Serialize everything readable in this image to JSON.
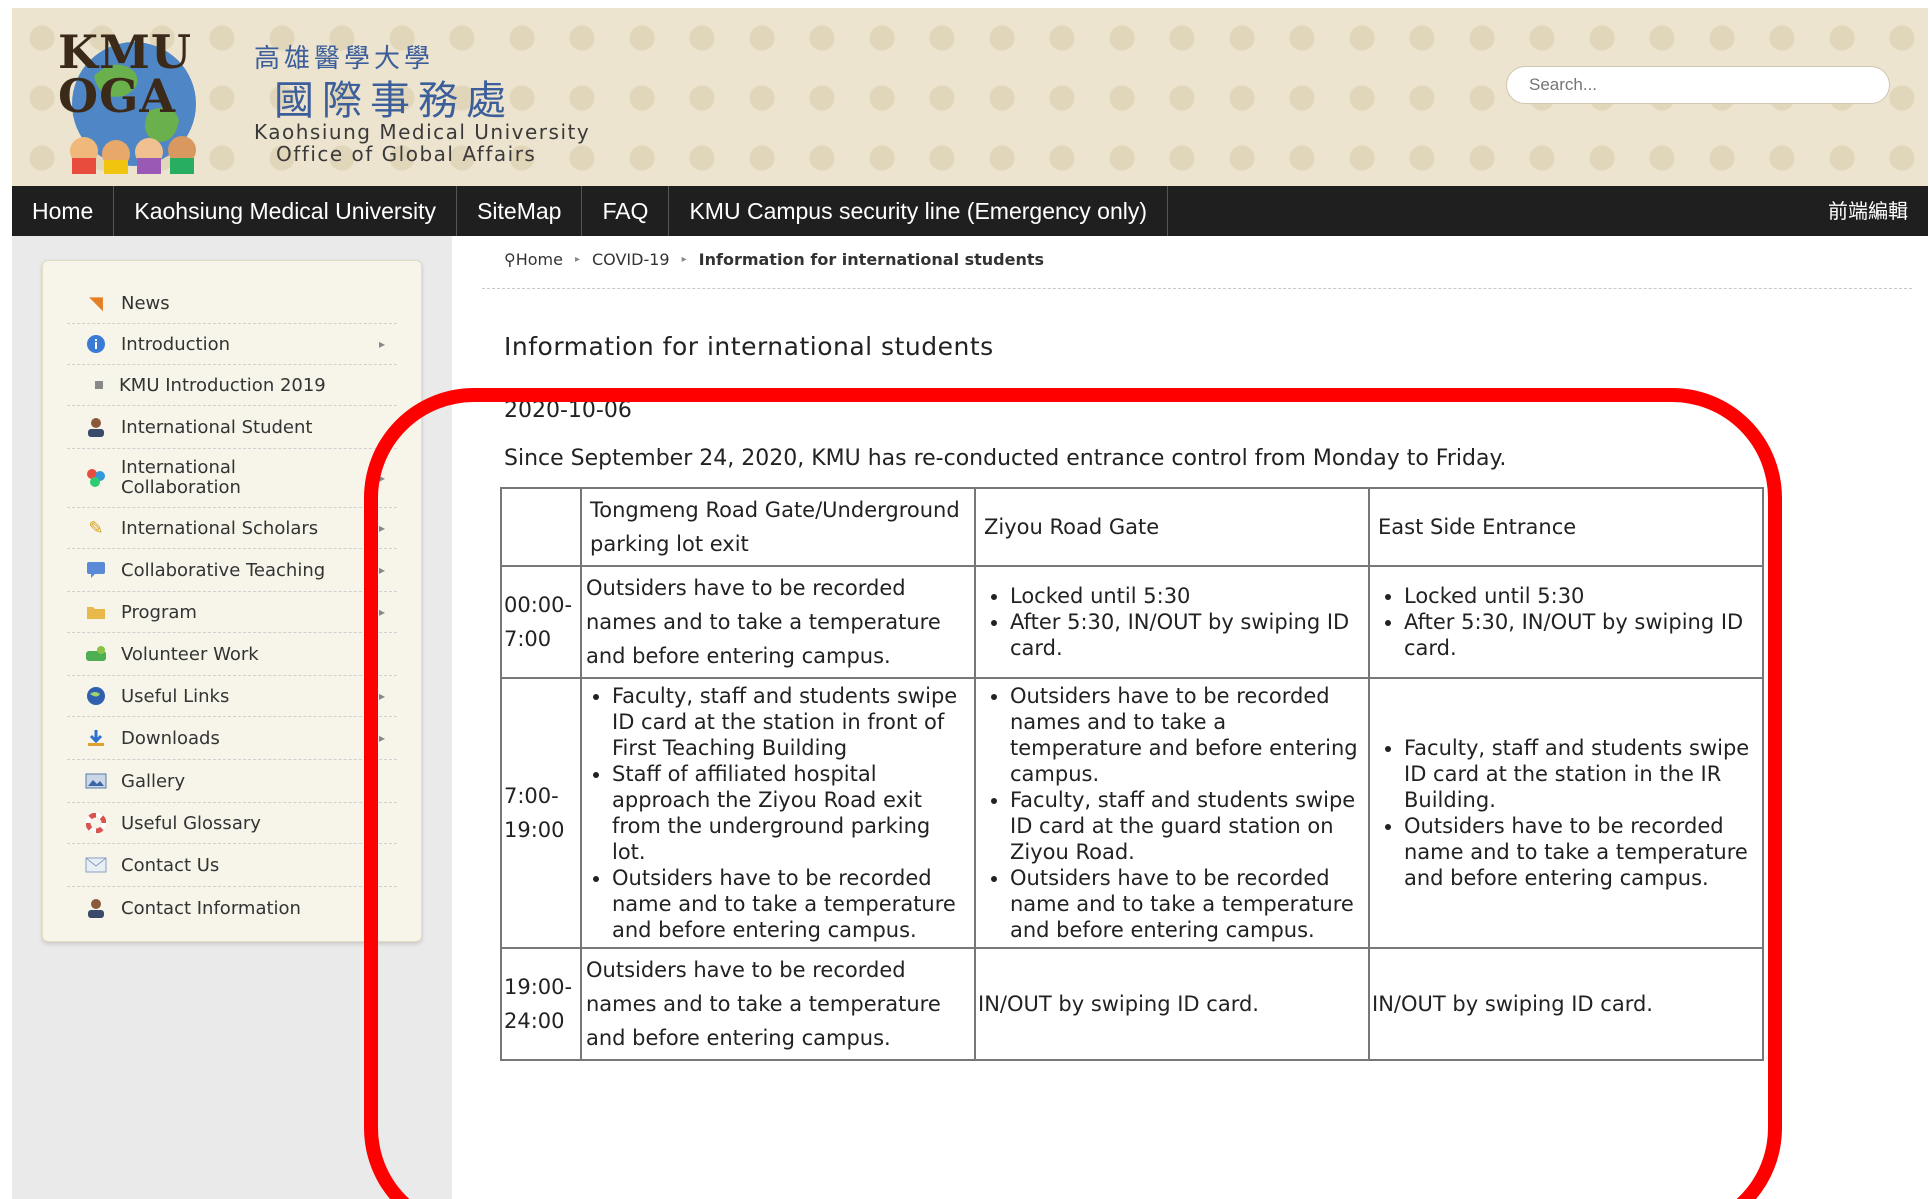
{
  "header": {
    "logo_text_1": "KMU",
    "logo_text_2": "OGA",
    "cn_university": "高雄醫學大學",
    "cn_office": "國際事務處",
    "en_university": "Kaohsiung Medical University",
    "en_office": "Office of Global Affairs",
    "search_placeholder": "Search..."
  },
  "nav": {
    "items": [
      "Home",
      "Kaohsiung Medical University",
      "SiteMap",
      "FAQ",
      "KMU Campus security line (Emergency only)"
    ],
    "right_label": "前端編輯"
  },
  "sidebar": {
    "items": [
      {
        "label": "News"
      },
      {
        "label": "Introduction"
      },
      {
        "label": "KMU Introduction 2019"
      },
      {
        "label": "International Student"
      },
      {
        "label": "International Collaboration"
      },
      {
        "label": "International Scholars"
      },
      {
        "label": "Collaborative Teaching"
      },
      {
        "label": "Program"
      },
      {
        "label": "Volunteer Work"
      },
      {
        "label": "Useful Links"
      },
      {
        "label": "Downloads"
      },
      {
        "label": "Gallery"
      },
      {
        "label": "Useful Glossary"
      },
      {
        "label": "Contact Us"
      },
      {
        "label": "Contact Information"
      }
    ]
  },
  "breadcrumb": {
    "home": "Home",
    "section": "COVID-19",
    "current": "Information for international students"
  },
  "article": {
    "title": "Information for international students",
    "date": "2020-10-06",
    "intro": "Since September 24, 2020, KMU has re-conducted entrance control from Monday to Friday."
  },
  "table": {
    "headers": [
      "",
      "Tongmeng Road Gate/Underground parking lot exit",
      "Ziyou Road Gate",
      "East Side Entrance"
    ],
    "rows": [
      {
        "time": "00:00-7:00",
        "tongmeng": "Outsiders have to be recorded names and to take a temperature and before entering campus.",
        "ziyou": [
          "Locked until 5:30",
          "After 5:30, IN/OUT by swiping ID card."
        ],
        "east": [
          "Locked until 5:30",
          "After 5:30, IN/OUT by swiping ID card."
        ]
      },
      {
        "time": "7:00-19:00",
        "tongmeng": [
          "Faculty, staff and students swipe ID card at the station in front of First Teaching Building",
          "Staff of affiliated hospital approach the Ziyou Road exit from the underground parking lot.",
          "Outsiders have to be recorded name and to take a temperature and before entering campus."
        ],
        "ziyou": [
          "Outsiders have to be recorded names and to take a temperature and before entering campus.",
          "Faculty, staff and students swipe ID card at the guard station on Ziyou Road.",
          "Outsiders have to be recorded name and to take a temperature and before entering campus."
        ],
        "east": [
          "Faculty, staff and students swipe ID card at the station in the IR Building.",
          "Outsiders have to be recorded name and to take a temperature and before entering campus."
        ]
      },
      {
        "time": "19:00-24:00",
        "tongmeng": "Outsiders have to be recorded names and to take a temperature and before entering campus.",
        "ziyou": "IN/OUT by swiping ID card.",
        "east": "IN/OUT by swiping ID card."
      }
    ]
  },
  "colors": {
    "nav_bg": "#1f1f1f",
    "highlight": "#ff0000",
    "cn_text": "#3c5e9a"
  }
}
